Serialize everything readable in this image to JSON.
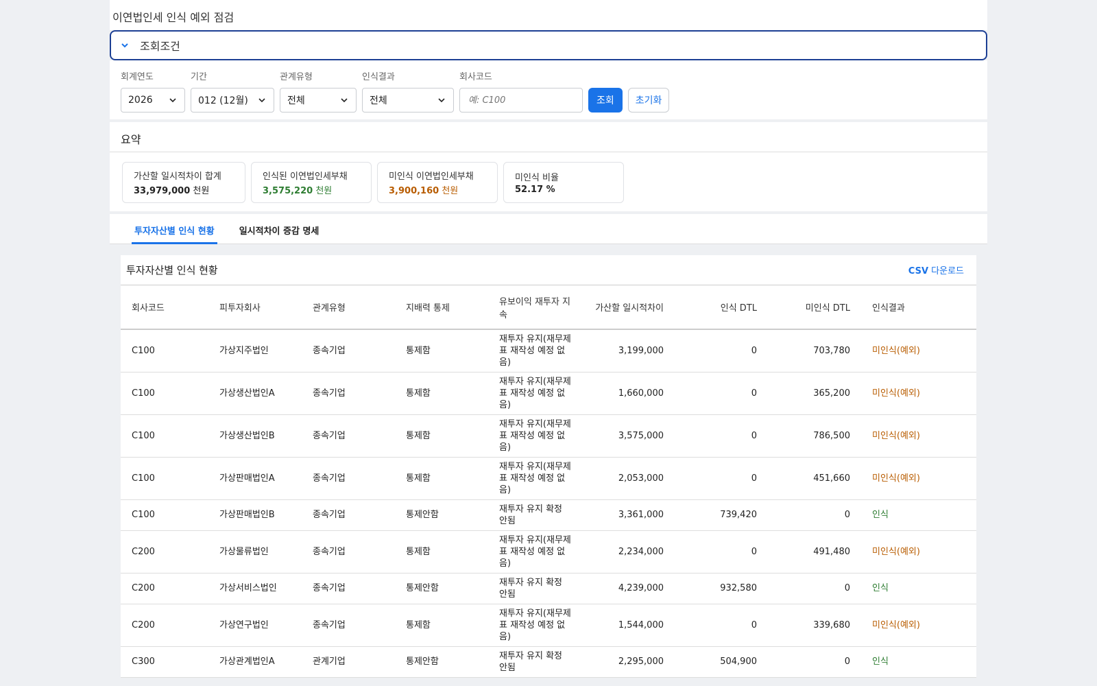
{
  "page_title": "이연법인세 인식 예외 점검",
  "conditions": {
    "header": "조회조건",
    "fiscal_year": {
      "label": "회계연도",
      "value": "2026"
    },
    "period": {
      "label": "기간",
      "value": "012 (12월)"
    },
    "relation_type": {
      "label": "관계유형",
      "value": "전체"
    },
    "recognition_result": {
      "label": "인식결과",
      "value": "전체"
    },
    "company_code": {
      "label": "회사코드",
      "placeholder": "예: C100"
    },
    "search_button": "조회",
    "reset_button": "초기화"
  },
  "summary": {
    "header": "요약",
    "cards": [
      {
        "label": "가산할 일시적차이 합계",
        "value": "33,979,000",
        "unit": "천원"
      },
      {
        "label": "인식된 이연법인세부채",
        "value": "3,575,220",
        "unit": "천원"
      },
      {
        "label": "미인식 이연법인세부채",
        "value": "3,900,160",
        "unit": "천원"
      },
      {
        "label": "미인식 비율",
        "value": "52.17 %",
        "unit": ""
      }
    ]
  },
  "tabs": [
    {
      "label": "투자자산별 인식 현황",
      "active": true
    },
    {
      "label": "일시적차이 증감 명세",
      "active": false
    }
  ],
  "grid": {
    "title": "투자자산별 인식 현황",
    "csv_prefix": "CSV",
    "csv_label": "다운로드",
    "columns": [
      "회사코드",
      "피투자회사",
      "관계유형",
      "지배력 통제",
      "유보이익 재투자 지속",
      "가산할 일시적차이",
      "인식 DTL",
      "미인식 DTL",
      "인식결과"
    ],
    "rows": [
      [
        "C100",
        "가상지주법인",
        "종속기업",
        "통제함",
        "재투자 유지(재무제표 재작성 예정 없음)",
        "3,199,000",
        "0",
        "703,780",
        "미인식(예외)"
      ],
      [
        "C100",
        "가상생산법인A",
        "종속기업",
        "통제함",
        "재투자 유지(재무제표 재작성 예정 없음)",
        "1,660,000",
        "0",
        "365,200",
        "미인식(예외)"
      ],
      [
        "C100",
        "가상생산법인B",
        "종속기업",
        "통제함",
        "재투자 유지(재무제표 재작성 예정 없음)",
        "3,575,000",
        "0",
        "786,500",
        "미인식(예외)"
      ],
      [
        "C100",
        "가상판매법인A",
        "종속기업",
        "통제함",
        "재투자 유지(재무제표 재작성 예정 없음)",
        "2,053,000",
        "0",
        "451,660",
        "미인식(예외)"
      ],
      [
        "C100",
        "가상판매법인B",
        "종속기업",
        "통제안함",
        "재투자 유지 확정 안됨",
        "3,361,000",
        "739,420",
        "0",
        "인식"
      ],
      [
        "C200",
        "가상물류법인",
        "종속기업",
        "통제함",
        "재투자 유지(재무제표 재작성 예정 없음)",
        "2,234,000",
        "0",
        "491,480",
        "미인식(예외)"
      ],
      [
        "C200",
        "가상서비스법인",
        "종속기업",
        "통제안함",
        "재투자 유지 확정 안됨",
        "4,239,000",
        "932,580",
        "0",
        "인식"
      ],
      [
        "C200",
        "가상연구법인",
        "종속기업",
        "통제함",
        "재투자 유지(재무제표 재작성 예정 없음)",
        "1,544,000",
        "0",
        "339,680",
        "미인식(예외)"
      ],
      [
        "C300",
        "가상관계법인A",
        "관계기업",
        "통제안함",
        "재투자 유지 확정 안됨",
        "2,295,000",
        "504,900",
        "0",
        "인식"
      ]
    ]
  },
  "colors": {
    "accent": "#1a73e8",
    "recognized": "#2e7d32",
    "unrecognized": "#b85c00",
    "border_focus": "#1c3f94"
  }
}
